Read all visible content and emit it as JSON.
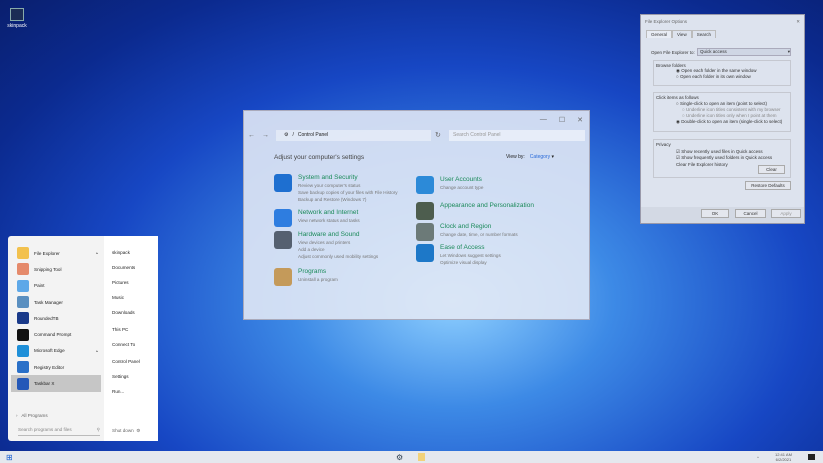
{
  "desktop": {
    "icons": [
      {
        "label": "skinpack"
      }
    ]
  },
  "control_panel": {
    "address": "Control Panel",
    "search_placeholder": "Search Control Panel",
    "heading": "Adjust your computer's settings",
    "view_by_label": "View by:",
    "view_by_value": "Category",
    "categories": [
      {
        "title": "System and Security",
        "links": [
          "Review your computer's status",
          "Save backup copies of your files with File History",
          "Backup and Restore (Windows 7)"
        ],
        "color": "#1e6fd0"
      },
      {
        "title": "Network and Internet",
        "links": [
          "View network status and tasks"
        ],
        "color": "#2e7de0"
      },
      {
        "title": "Hardware and Sound",
        "links": [
          "View devices and printers",
          "Add a device",
          "Adjust commonly used mobility settings"
        ],
        "color": "#556070"
      },
      {
        "title": "Programs",
        "links": [
          "Uninstall a program"
        ],
        "color": "#c49a5a"
      },
      {
        "title": "User Accounts",
        "links": [
          "Change account type"
        ],
        "color": "#2c8ad8"
      },
      {
        "title": "Appearance and Personalization",
        "links": [],
        "color": "#4d5d4e"
      },
      {
        "title": "Clock and Region",
        "links": [
          "Change date, time, or number formats"
        ],
        "color": "#6c7a78"
      },
      {
        "title": "Ease of Access",
        "links": [
          "Let Windows suggest settings",
          "Optimize visual display"
        ],
        "color": "#1d78c8"
      }
    ]
  },
  "folder_options": {
    "title": "File Explorer Options",
    "tabs": [
      "General",
      "View",
      "Search"
    ],
    "open_to_label": "Open File Explorer to:",
    "open_to_value": "Quick access",
    "browse_label": "Browse folders",
    "browse_opts": [
      "Open each folder in the same window",
      "Open each folder in its own window"
    ],
    "click_label": "Click items as follows",
    "click_opts": [
      "Single-click to open an item (point to select)",
      "Underline icon titles consistent with my browser",
      "Underline icon titles only when I point at them",
      "Double-click to open an item (single-click to select)"
    ],
    "privacy_label": "Privacy",
    "privacy_opts": [
      "Show recently used files in Quick access",
      "Show frequently used folders in Quick access"
    ],
    "clear_label": "Clear File Explorer history",
    "clear_btn": "Clear",
    "restore_btn": "Restore Defaults",
    "ok": "OK",
    "cancel": "Cancel",
    "apply": "Apply"
  },
  "start_menu": {
    "programs": [
      {
        "label": "File Explorer",
        "color": "#f2c14e"
      },
      {
        "label": "Snipping Tool",
        "color": "#e58a6b"
      },
      {
        "label": "Paint",
        "color": "#5ea8e8"
      },
      {
        "label": "Task Manager",
        "color": "#5a8fc0"
      },
      {
        "label": "RoundedTB",
        "color": "#1a3a8a"
      },
      {
        "label": "Command Prompt",
        "color": "#111111"
      },
      {
        "label": "Microsoft Edge",
        "color": "#1e8fd8"
      },
      {
        "label": "Registry Editor",
        "color": "#2a70c8"
      },
      {
        "label": "Taskbar X",
        "color": "#2458b8"
      }
    ],
    "places": [
      "skinpack",
      "Documents",
      "Pictures",
      "Music",
      "Downloads",
      "This PC",
      "Connect To",
      "Control Panel",
      "Settings",
      "Run..."
    ],
    "all_programs": "All Programs",
    "search_placeholder": "Search programs and files",
    "shutdown": "Shut down"
  },
  "taskbar": {
    "time": "12:41 AM",
    "date": "6/2/2021"
  }
}
